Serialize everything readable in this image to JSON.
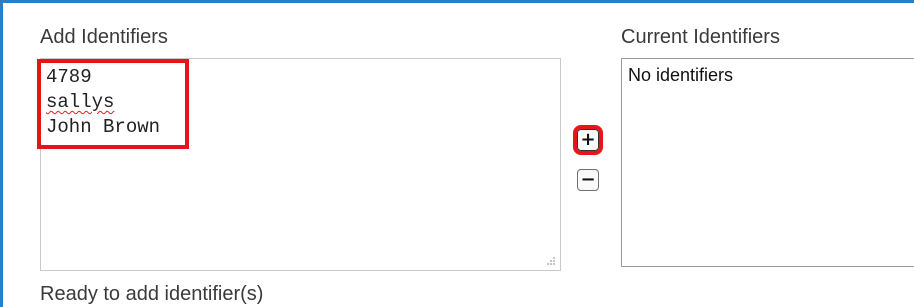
{
  "add_section": {
    "label": "Add Identifiers",
    "entries": [
      "4789",
      "sallys",
      "John Brown"
    ],
    "status": "Ready to add identifier(s)"
  },
  "current_section": {
    "label": "Current Identifiers",
    "empty_text": "No identifiers"
  },
  "buttons": {
    "add_symbol": "+",
    "remove_symbol": "−"
  },
  "colors": {
    "highlight": "#e8141b",
    "frame_border": "#2a7fc8",
    "spellcheck": "#e02020"
  },
  "icons": {
    "add": "plus-icon",
    "remove": "minus-icon",
    "resize": "resize-grip-icon"
  }
}
